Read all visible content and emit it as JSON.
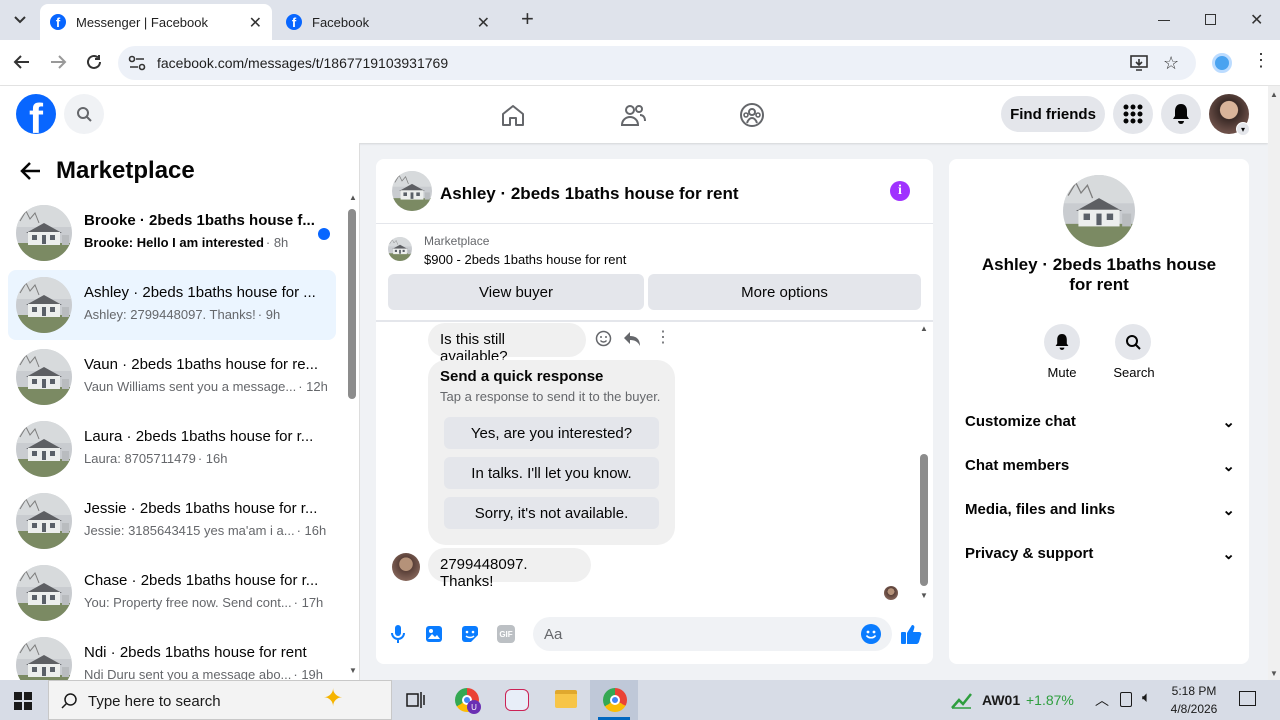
{
  "browser": {
    "tabs": [
      {
        "title": "Messenger | Facebook",
        "active": true
      },
      {
        "title": "Facebook",
        "active": false
      }
    ],
    "url": "facebook.com/messages/t/1867719103931769"
  },
  "header": {
    "find_friends": "Find friends"
  },
  "sidebar": {
    "title": "Marketplace",
    "conversations": [
      {
        "name": "Brooke · 2beds 1baths house f...",
        "preview": "Brooke: Hello I am interested",
        "time": "· 8h",
        "unread": true
      },
      {
        "name": "Ashley · 2beds 1baths house for ...",
        "preview": "Ashley: 2799448097. Thanks!",
        "time": "· 9h",
        "selected": true
      },
      {
        "name": "Vaun · 2beds 1baths house for re...",
        "preview": "Vaun Williams sent you a message...",
        "time": "· 12h"
      },
      {
        "name": "Laura · 2beds 1baths house for r...",
        "preview": "Laura: 8705711479",
        "time": "· 16h"
      },
      {
        "name": "Jessie · 2beds 1baths house for r...",
        "preview": "Jessie: 3185643415 yes ma'am i a...",
        "time": "· 16h"
      },
      {
        "name": "Chase · 2beds 1baths house for r...",
        "preview": "You: Property free now. Send cont...",
        "time": "· 17h"
      },
      {
        "name": "Ndi · 2beds 1baths house for rent",
        "preview": "Ndi Duru sent you a message abo...",
        "time": "· 19h"
      }
    ]
  },
  "chat": {
    "title": "Ashley · 2beds 1baths house for rent",
    "listing_source": "Marketplace",
    "listing": "$900 - 2beds 1baths house for rent",
    "view_buyer": "View buyer",
    "more_options": "More options",
    "msg_available": "Is this still available?",
    "quick_title": "Send a quick response",
    "quick_sub": "Tap a response to send it to the buyer.",
    "quick_responses": [
      "Yes, are you interested?",
      "In talks. I'll let you know.",
      "Sorry, it's not available."
    ],
    "msg_buyer": "2799448097. Thanks!",
    "composer_placeholder": "Aa"
  },
  "info_panel": {
    "title": "Ashley · 2beds 1baths house for rent",
    "mute": "Mute",
    "search": "Search",
    "sections": [
      "Customize chat",
      "Chat members",
      "Media, files and links",
      "Privacy & support"
    ]
  },
  "taskbar": {
    "search_placeholder": "Type here to search",
    "ticker": "AW01",
    "ticker_change": "+1.87%",
    "time": "5:18 PM",
    "date": "4/8/2026"
  },
  "colors": {
    "fb_blue": "#0866ff",
    "messenger_accent": "#0a7cff",
    "info_purple": "#a033ff",
    "selected_row": "#ebf5ff"
  }
}
